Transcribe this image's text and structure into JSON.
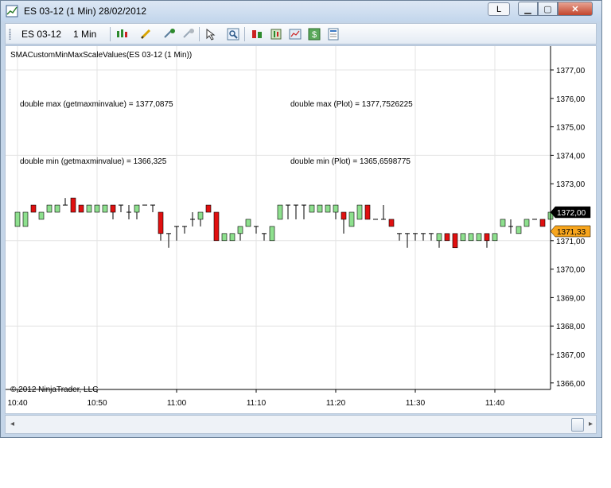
{
  "window": {
    "title": "ES 03-12 (1 Min)  28/02/2012",
    "language_indicator": "L",
    "minimize_icon": "minimize-icon",
    "maximize_icon": "maximize-icon",
    "close_icon": "close-icon"
  },
  "toolbar": {
    "instrument": "ES 03-12",
    "interval": "1 Min",
    "icons": [
      "candlestick-style-icon",
      "drawing-pencil-icon",
      "cursor-tool-icon",
      "crosshair-icon",
      "pointer-arrow-icon",
      "zoom-icon",
      "indicators-icon",
      "strategies-icon",
      "chart-properties-icon",
      "dollar-icon",
      "data-box-icon"
    ]
  },
  "chart": {
    "indicator_label": "SMACustomMinMaxScaleValues(ES 03-12 (1 Min))",
    "info_lines": {
      "max_getmaxmin": "double max (getmaxminvalue) = 1377,0875",
      "max_plot": "double max (Plot) = 1377,7526225",
      "min_getmaxmin": "double min (getmaxminvalue) = 1366,325",
      "min_plot": "double min (Plot) = 1365,6598775"
    },
    "copyright": "© 2012 NinjaTrader, LLC",
    "last_price": "1372,00",
    "sma_value": "1371,33",
    "colors": {
      "up": "#8ee08e",
      "down": "#e01010",
      "last_price_bg": "#000000",
      "sma_bg": "#f7a51d"
    }
  },
  "chart_data": {
    "type": "candlestick",
    "title": "SMACustomMinMaxScaleValues(ES 03-12 (1 Min))",
    "y_ticks": [
      "1366,00",
      "1367,00",
      "1368,00",
      "1369,00",
      "1370,00",
      "1371,00",
      "1372,00",
      "1373,00",
      "1374,00",
      "1375,00",
      "1376,00",
      "1377,00"
    ],
    "x_ticks": [
      "10:40",
      "10:50",
      "11:00",
      "11:10",
      "11:20",
      "11:30",
      "11:40"
    ],
    "ylim": [
      1365.8,
      1377.5
    ],
    "start_time": "10:40",
    "grid": true,
    "bars": [
      {
        "o": 1371.5,
        "h": 1372.0,
        "l": 1371.5,
        "c": 1372.0
      },
      {
        "o": 1371.5,
        "h": 1372.0,
        "l": 1371.5,
        "c": 1372.0
      },
      {
        "o": 1372.25,
        "h": 1372.25,
        "l": 1372.0,
        "c": 1372.0
      },
      {
        "o": 1371.75,
        "h": 1372.0,
        "l": 1371.75,
        "c": 1372.0
      },
      {
        "o": 1372.0,
        "h": 1372.25,
        "l": 1372.0,
        "c": 1372.25
      },
      {
        "o": 1372.0,
        "h": 1372.25,
        "l": 1372.0,
        "c": 1372.25
      },
      {
        "o": 1372.25,
        "h": 1372.5,
        "l": 1372.25,
        "c": 1372.25
      },
      {
        "o": 1372.5,
        "h": 1372.5,
        "l": 1372.0,
        "c": 1372.0
      },
      {
        "o": 1372.25,
        "h": 1372.25,
        "l": 1372.0,
        "c": 1372.0
      },
      {
        "o": 1372.0,
        "h": 1372.25,
        "l": 1372.0,
        "c": 1372.25
      },
      {
        "o": 1372.0,
        "h": 1372.25,
        "l": 1372.0,
        "c": 1372.25
      },
      {
        "o": 1372.0,
        "h": 1372.25,
        "l": 1372.0,
        "c": 1372.25
      },
      {
        "o": 1372.25,
        "h": 1372.25,
        "l": 1371.75,
        "c": 1372.0
      },
      {
        "o": 1372.25,
        "h": 1372.25,
        "l": 1372.0,
        "c": 1372.25
      },
      {
        "o": 1372.0,
        "h": 1372.25,
        "l": 1371.75,
        "c": 1372.0
      },
      {
        "o": 1372.0,
        "h": 1372.25,
        "l": 1371.75,
        "c": 1372.25
      },
      {
        "o": 1372.25,
        "h": 1372.25,
        "l": 1372.25,
        "c": 1372.25
      },
      {
        "o": 1372.25,
        "h": 1372.25,
        "l": 1372.0,
        "c": 1372.25
      },
      {
        "o": 1372.0,
        "h": 1372.0,
        "l": 1371.0,
        "c": 1371.25
      },
      {
        "o": 1371.25,
        "h": 1371.25,
        "l": 1370.75,
        "c": 1371.25
      },
      {
        "o": 1371.5,
        "h": 1371.5,
        "l": 1371.0,
        "c": 1371.5
      },
      {
        "o": 1371.5,
        "h": 1371.5,
        "l": 1371.25,
        "c": 1371.5
      },
      {
        "o": 1371.75,
        "h": 1372.0,
        "l": 1371.5,
        "c": 1371.75
      },
      {
        "o": 1371.75,
        "h": 1372.0,
        "l": 1371.5,
        "c": 1372.0
      },
      {
        "o": 1372.25,
        "h": 1372.25,
        "l": 1372.0,
        "c": 1372.0
      },
      {
        "o": 1372.0,
        "h": 1372.0,
        "l": 1371.0,
        "c": 1371.0
      },
      {
        "o": 1371.0,
        "h": 1371.25,
        "l": 1371.0,
        "c": 1371.25
      },
      {
        "o": 1371.0,
        "h": 1371.25,
        "l": 1371.0,
        "c": 1371.25
      },
      {
        "o": 1371.25,
        "h": 1371.5,
        "l": 1371.0,
        "c": 1371.5
      },
      {
        "o": 1371.5,
        "h": 1371.75,
        "l": 1371.5,
        "c": 1371.75
      },
      {
        "o": 1371.5,
        "h": 1371.5,
        "l": 1371.25,
        "c": 1371.5
      },
      {
        "o": 1371.25,
        "h": 1371.25,
        "l": 1371.0,
        "c": 1371.25
      },
      {
        "o": 1371.0,
        "h": 1371.5,
        "l": 1371.0,
        "c": 1371.5
      },
      {
        "o": 1371.75,
        "h": 1372.25,
        "l": 1371.75,
        "c": 1372.25
      },
      {
        "o": 1372.25,
        "h": 1372.25,
        "l": 1371.75,
        "c": 1372.25
      },
      {
        "o": 1372.25,
        "h": 1372.25,
        "l": 1371.75,
        "c": 1372.25
      },
      {
        "o": 1372.25,
        "h": 1372.25,
        "l": 1371.75,
        "c": 1372.25
      },
      {
        "o": 1372.0,
        "h": 1372.25,
        "l": 1372.0,
        "c": 1372.25
      },
      {
        "o": 1372.0,
        "h": 1372.25,
        "l": 1372.0,
        "c": 1372.25
      },
      {
        "o": 1372.0,
        "h": 1372.25,
        "l": 1372.0,
        "c": 1372.25
      },
      {
        "o": 1372.0,
        "h": 1372.25,
        "l": 1371.75,
        "c": 1372.25
      },
      {
        "o": 1372.0,
        "h": 1372.0,
        "l": 1371.25,
        "c": 1371.75
      },
      {
        "o": 1371.5,
        "h": 1372.0,
        "l": 1371.5,
        "c": 1372.0
      },
      {
        "o": 1371.75,
        "h": 1372.25,
        "l": 1371.75,
        "c": 1372.25
      },
      {
        "o": 1372.25,
        "h": 1372.25,
        "l": 1371.75,
        "c": 1371.75
      },
      {
        "o": 1371.75,
        "h": 1371.75,
        "l": 1371.75,
        "c": 1371.75
      },
      {
        "o": 1371.75,
        "h": 1372.25,
        "l": 1371.75,
        "c": 1371.75
      },
      {
        "o": 1371.75,
        "h": 1371.75,
        "l": 1371.5,
        "c": 1371.5
      },
      {
        "o": 1371.25,
        "h": 1371.25,
        "l": 1371.0,
        "c": 1371.25
      },
      {
        "o": 1371.25,
        "h": 1371.25,
        "l": 1370.75,
        "c": 1371.25
      },
      {
        "o": 1371.25,
        "h": 1371.25,
        "l": 1371.0,
        "c": 1371.25
      },
      {
        "o": 1371.25,
        "h": 1371.25,
        "l": 1371.0,
        "c": 1371.25
      },
      {
        "o": 1371.25,
        "h": 1371.25,
        "l": 1371.0,
        "c": 1371.25
      },
      {
        "o": 1371.0,
        "h": 1371.25,
        "l": 1370.75,
        "c": 1371.25
      },
      {
        "o": 1371.25,
        "h": 1371.25,
        "l": 1371.0,
        "c": 1371.0
      },
      {
        "o": 1371.25,
        "h": 1371.25,
        "l": 1370.75,
        "c": 1370.75
      },
      {
        "o": 1371.0,
        "h": 1371.25,
        "l": 1371.0,
        "c": 1371.25
      },
      {
        "o": 1371.0,
        "h": 1371.25,
        "l": 1371.0,
        "c": 1371.25
      },
      {
        "o": 1371.0,
        "h": 1371.25,
        "l": 1371.0,
        "c": 1371.25
      },
      {
        "o": 1371.25,
        "h": 1371.25,
        "l": 1370.75,
        "c": 1371.0
      },
      {
        "o": 1371.0,
        "h": 1371.25,
        "l": 1371.0,
        "c": 1371.25
      },
      {
        "o": 1371.5,
        "h": 1371.75,
        "l": 1371.5,
        "c": 1371.75
      },
      {
        "o": 1371.5,
        "h": 1371.75,
        "l": 1371.25,
        "c": 1371.5
      },
      {
        "o": 1371.25,
        "h": 1371.5,
        "l": 1371.25,
        "c": 1371.5
      },
      {
        "o": 1371.5,
        "h": 1371.75,
        "l": 1371.5,
        "c": 1371.75
      },
      {
        "o": 1371.75,
        "h": 1371.75,
        "l": 1371.75,
        "c": 1371.75
      },
      {
        "o": 1371.75,
        "h": 1371.75,
        "l": 1371.5,
        "c": 1371.5
      },
      {
        "o": 1371.75,
        "h": 1372.0,
        "l": 1371.75,
        "c": 1372.0
      }
    ]
  }
}
